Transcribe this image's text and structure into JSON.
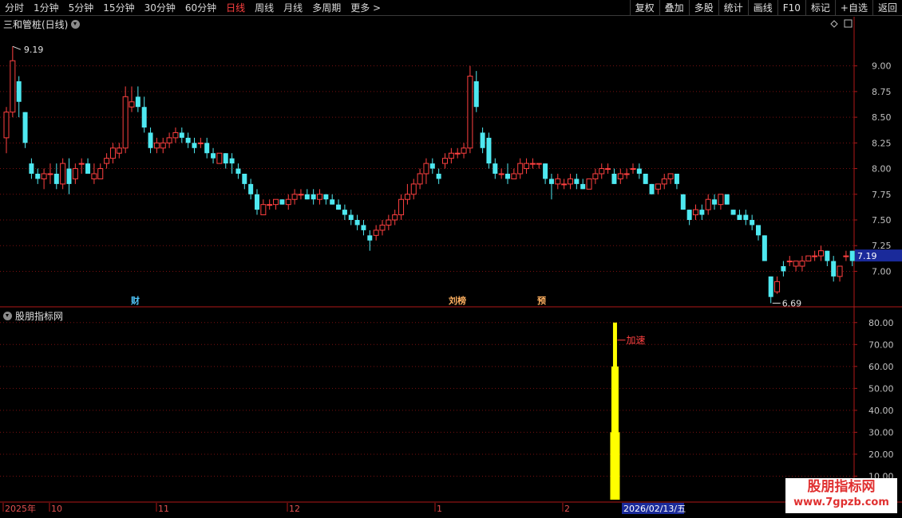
{
  "toolbar": {
    "periods": [
      "分时",
      "1分钟",
      "5分钟",
      "15分钟",
      "30分钟",
      "60分钟",
      "日线",
      "周线",
      "月线",
      "多周期",
      "更多 >"
    ],
    "active_period": "日线",
    "right_buttons": [
      "复权",
      "叠加",
      "多股",
      "统计",
      "画线",
      "F10",
      "标记",
      "+自选",
      "返回"
    ]
  },
  "main_panel": {
    "title": "三和管桩(日线)",
    "high_label": "9.19",
    "low_label": "6.69",
    "current_price": "7.19",
    "event_markers": [
      {
        "text": "财",
        "color": "#4fc3f7"
      },
      {
        "text": "刘榜",
        "color": "#ffb060"
      },
      {
        "text": "预",
        "color": "#ffb060"
      }
    ]
  },
  "indicator_panel": {
    "title": "股朋指标网",
    "signal_label": "加速"
  },
  "time_axis": {
    "labels": [
      "2025年",
      "10",
      "11",
      "12",
      "1",
      "2"
    ],
    "cursor_date": "2026/02/13/五"
  },
  "watermark": {
    "line1": "股朋指标网",
    "line2": "www.7gpzb.com"
  },
  "colors": {
    "up": "#ff4040",
    "down": "#4ee8f0",
    "grid": "#7a1010",
    "axis": "#b01818",
    "indicator_bar": "#ffff00",
    "price_box": "#1a2a9a"
  },
  "chart_data": [
    {
      "type": "candlestick",
      "title": "三和管桩(日线)",
      "ylim": [
        6.6,
        9.3
      ],
      "yticks": [
        7.0,
        7.25,
        7.5,
        7.75,
        8.0,
        8.25,
        8.5,
        8.75,
        9.0
      ],
      "ohlc": [
        [
          8.3,
          8.6,
          8.15,
          8.55
        ],
        [
          8.55,
          9.19,
          8.5,
          9.05
        ],
        [
          8.85,
          8.9,
          8.5,
          8.65
        ],
        [
          8.55,
          8.55,
          8.2,
          8.25
        ],
        [
          8.05,
          8.1,
          7.9,
          7.95
        ],
        [
          7.95,
          8.0,
          7.85,
          7.9
        ],
        [
          7.9,
          8.0,
          7.8,
          7.95
        ],
        [
          7.95,
          8.05,
          7.85,
          7.95
        ],
        [
          7.95,
          8.05,
          7.8,
          7.85
        ],
        [
          7.85,
          8.1,
          7.8,
          8.05
        ],
        [
          8.0,
          8.1,
          7.75,
          7.85
        ],
        [
          7.9,
          8.05,
          7.85,
          8.0
        ],
        [
          8.05,
          8.1,
          7.95,
          8.05
        ],
        [
          8.05,
          8.1,
          7.95,
          7.95
        ],
        [
          7.9,
          8.05,
          7.85,
          7.95
        ],
        [
          7.9,
          8.05,
          7.9,
          8.0
        ],
        [
          8.05,
          8.15,
          8.0,
          8.1
        ],
        [
          8.1,
          8.25,
          8.05,
          8.2
        ],
        [
          8.15,
          8.25,
          8.1,
          8.2
        ],
        [
          8.2,
          8.8,
          8.15,
          8.7
        ],
        [
          8.6,
          8.8,
          8.55,
          8.65
        ],
        [
          8.7,
          8.8,
          8.55,
          8.6
        ],
        [
          8.6,
          8.7,
          8.35,
          8.4
        ],
        [
          8.35,
          8.4,
          8.15,
          8.2
        ],
        [
          8.2,
          8.3,
          8.15,
          8.25
        ],
        [
          8.2,
          8.3,
          8.15,
          8.25
        ],
        [
          8.25,
          8.35,
          8.2,
          8.3
        ],
        [
          8.3,
          8.4,
          8.25,
          8.35
        ],
        [
          8.35,
          8.4,
          8.25,
          8.3
        ],
        [
          8.3,
          8.35,
          8.2,
          8.25
        ],
        [
          8.25,
          8.3,
          8.15,
          8.2
        ],
        [
          8.25,
          8.3,
          8.2,
          8.25
        ],
        [
          8.25,
          8.3,
          8.1,
          8.15
        ],
        [
          8.15,
          8.2,
          8.05,
          8.1
        ],
        [
          8.05,
          8.15,
          8.05,
          8.15
        ],
        [
          8.15,
          8.15,
          8.0,
          8.05
        ],
        [
          8.1,
          8.15,
          7.95,
          8.05
        ],
        [
          8.0,
          8.05,
          7.9,
          7.95
        ],
        [
          7.95,
          7.95,
          7.8,
          7.85
        ],
        [
          7.85,
          7.9,
          7.7,
          7.75
        ],
        [
          7.75,
          7.8,
          7.55,
          7.6
        ],
        [
          7.55,
          7.7,
          7.55,
          7.65
        ],
        [
          7.65,
          7.7,
          7.6,
          7.65
        ],
        [
          7.65,
          7.7,
          7.6,
          7.7
        ],
        [
          7.7,
          7.7,
          7.65,
          7.65
        ],
        [
          7.65,
          7.75,
          7.6,
          7.7
        ],
        [
          7.7,
          7.8,
          7.65,
          7.75
        ],
        [
          7.75,
          7.8,
          7.7,
          7.75
        ],
        [
          7.75,
          7.8,
          7.7,
          7.7
        ],
        [
          7.75,
          7.8,
          7.65,
          7.7
        ],
        [
          7.7,
          7.8,
          7.65,
          7.75
        ],
        [
          7.75,
          7.75,
          7.65,
          7.7
        ],
        [
          7.7,
          7.75,
          7.65,
          7.65
        ],
        [
          7.65,
          7.7,
          7.6,
          7.6
        ],
        [
          7.6,
          7.65,
          7.5,
          7.55
        ],
        [
          7.55,
          7.6,
          7.45,
          7.5
        ],
        [
          7.5,
          7.55,
          7.4,
          7.45
        ],
        [
          7.45,
          7.5,
          7.35,
          7.4
        ],
        [
          7.35,
          7.4,
          7.2,
          7.3
        ],
        [
          7.35,
          7.45,
          7.3,
          7.4
        ],
        [
          7.4,
          7.5,
          7.35,
          7.45
        ],
        [
          7.45,
          7.55,
          7.4,
          7.5
        ],
        [
          7.5,
          7.6,
          7.45,
          7.55
        ],
        [
          7.55,
          7.75,
          7.5,
          7.7
        ],
        [
          7.7,
          7.85,
          7.65,
          7.75
        ],
        [
          7.75,
          7.9,
          7.7,
          7.85
        ],
        [
          7.85,
          8.0,
          7.8,
          7.95
        ],
        [
          7.95,
          8.1,
          7.85,
          8.05
        ],
        [
          8.05,
          8.1,
          7.95,
          8.0
        ],
        [
          7.95,
          8.0,
          7.85,
          7.9
        ],
        [
          8.05,
          8.15,
          8.0,
          8.1
        ],
        [
          8.1,
          8.2,
          8.05,
          8.15
        ],
        [
          8.15,
          8.2,
          8.1,
          8.15
        ],
        [
          8.15,
          8.25,
          8.1,
          8.2
        ],
        [
          8.2,
          9.0,
          8.15,
          8.9
        ],
        [
          8.85,
          8.95,
          8.55,
          8.6
        ],
        [
          8.35,
          8.4,
          8.15,
          8.2
        ],
        [
          8.3,
          8.35,
          8.0,
          8.05
        ],
        [
          8.05,
          8.1,
          7.9,
          7.95
        ],
        [
          7.95,
          8.0,
          7.9,
          7.95
        ],
        [
          7.95,
          8.05,
          7.85,
          7.9
        ],
        [
          7.9,
          8.0,
          7.9,
          7.95
        ],
        [
          7.95,
          8.1,
          7.9,
          8.05
        ],
        [
          8.0,
          8.1,
          7.95,
          8.05
        ],
        [
          8.05,
          8.1,
          8.0,
          8.05
        ],
        [
          8.05,
          8.05,
          8.0,
          8.05
        ],
        [
          8.05,
          8.05,
          7.85,
          7.9
        ],
        [
          7.9,
          7.95,
          7.7,
          7.85
        ],
        [
          7.85,
          7.95,
          7.8,
          7.9
        ],
        [
          7.85,
          7.9,
          7.8,
          7.85
        ],
        [
          7.85,
          7.95,
          7.8,
          7.9
        ],
        [
          7.9,
          7.95,
          7.8,
          7.85
        ],
        [
          7.85,
          7.9,
          7.8,
          7.8
        ],
        [
          7.8,
          7.9,
          7.8,
          7.9
        ],
        [
          7.9,
          8.0,
          7.85,
          7.95
        ],
        [
          7.95,
          8.05,
          7.9,
          8.0
        ],
        [
          8.0,
          8.05,
          7.95,
          8.0
        ],
        [
          7.95,
          8.0,
          7.85,
          7.85
        ],
        [
          7.9,
          8.0,
          7.85,
          7.95
        ],
        [
          7.95,
          8.0,
          7.9,
          7.95
        ],
        [
          8.0,
          8.05,
          7.95,
          8.0
        ],
        [
          8.0,
          8.05,
          7.9,
          7.95
        ],
        [
          7.95,
          7.95,
          7.85,
          7.85
        ],
        [
          7.85,
          7.85,
          7.75,
          7.75
        ],
        [
          7.8,
          7.85,
          7.75,
          7.85
        ],
        [
          7.85,
          7.95,
          7.8,
          7.9
        ],
        [
          7.9,
          7.95,
          7.85,
          7.95
        ],
        [
          7.95,
          7.95,
          7.8,
          7.85
        ],
        [
          7.75,
          7.75,
          7.6,
          7.6
        ],
        [
          7.6,
          7.6,
          7.45,
          7.5
        ],
        [
          7.55,
          7.65,
          7.5,
          7.6
        ],
        [
          7.6,
          7.65,
          7.5,
          7.55
        ],
        [
          7.6,
          7.75,
          7.55,
          7.7
        ],
        [
          7.7,
          7.75,
          7.6,
          7.65
        ],
        [
          7.65,
          7.75,
          7.6,
          7.75
        ],
        [
          7.75,
          7.75,
          7.65,
          7.65
        ],
        [
          7.6,
          7.6,
          7.55,
          7.55
        ],
        [
          7.55,
          7.6,
          7.5,
          7.5
        ],
        [
          7.55,
          7.6,
          7.45,
          7.5
        ],
        [
          7.5,
          7.55,
          7.4,
          7.45
        ],
        [
          7.45,
          7.45,
          7.3,
          7.35
        ],
        [
          7.35,
          7.35,
          7.1,
          7.1
        ],
        [
          6.95,
          6.95,
          6.69,
          6.75
        ],
        [
          6.8,
          6.95,
          6.78,
          6.9
        ],
        [
          7.05,
          7.1,
          6.95,
          7.0
        ],
        [
          7.1,
          7.15,
          7.05,
          7.1
        ],
        [
          7.05,
          7.1,
          7.0,
          7.1
        ],
        [
          7.05,
          7.15,
          7.0,
          7.1
        ],
        [
          7.1,
          7.15,
          7.1,
          7.15
        ],
        [
          7.15,
          7.2,
          7.1,
          7.15
        ],
        [
          7.15,
          7.25,
          7.1,
          7.2
        ],
        [
          7.2,
          7.2,
          7.05,
          7.1
        ],
        [
          7.1,
          7.15,
          6.9,
          6.95
        ],
        [
          6.95,
          7.05,
          6.9,
          7.05
        ],
        [
          7.15,
          7.2,
          7.1,
          7.15
        ],
        [
          7.2,
          7.2,
          7.05,
          7.1
        ],
        [
          7.1,
          7.15,
          7.1,
          7.15
        ]
      ]
    },
    {
      "type": "bar",
      "title": "股朋指标网",
      "ylim": [
        0,
        85
      ],
      "yticks": [
        10.0,
        20.0,
        30.0,
        40.0,
        50.0,
        60.0,
        70.0,
        80.0
      ],
      "series": [
        {
          "name": "加速",
          "points": [
            {
              "candle": 97,
              "value": 30,
              "width": "wide"
            },
            {
              "candle": 97,
              "value": 60,
              "width": "medium"
            },
            {
              "candle": 97,
              "value": 80,
              "width": "narrow"
            }
          ]
        }
      ]
    }
  ]
}
